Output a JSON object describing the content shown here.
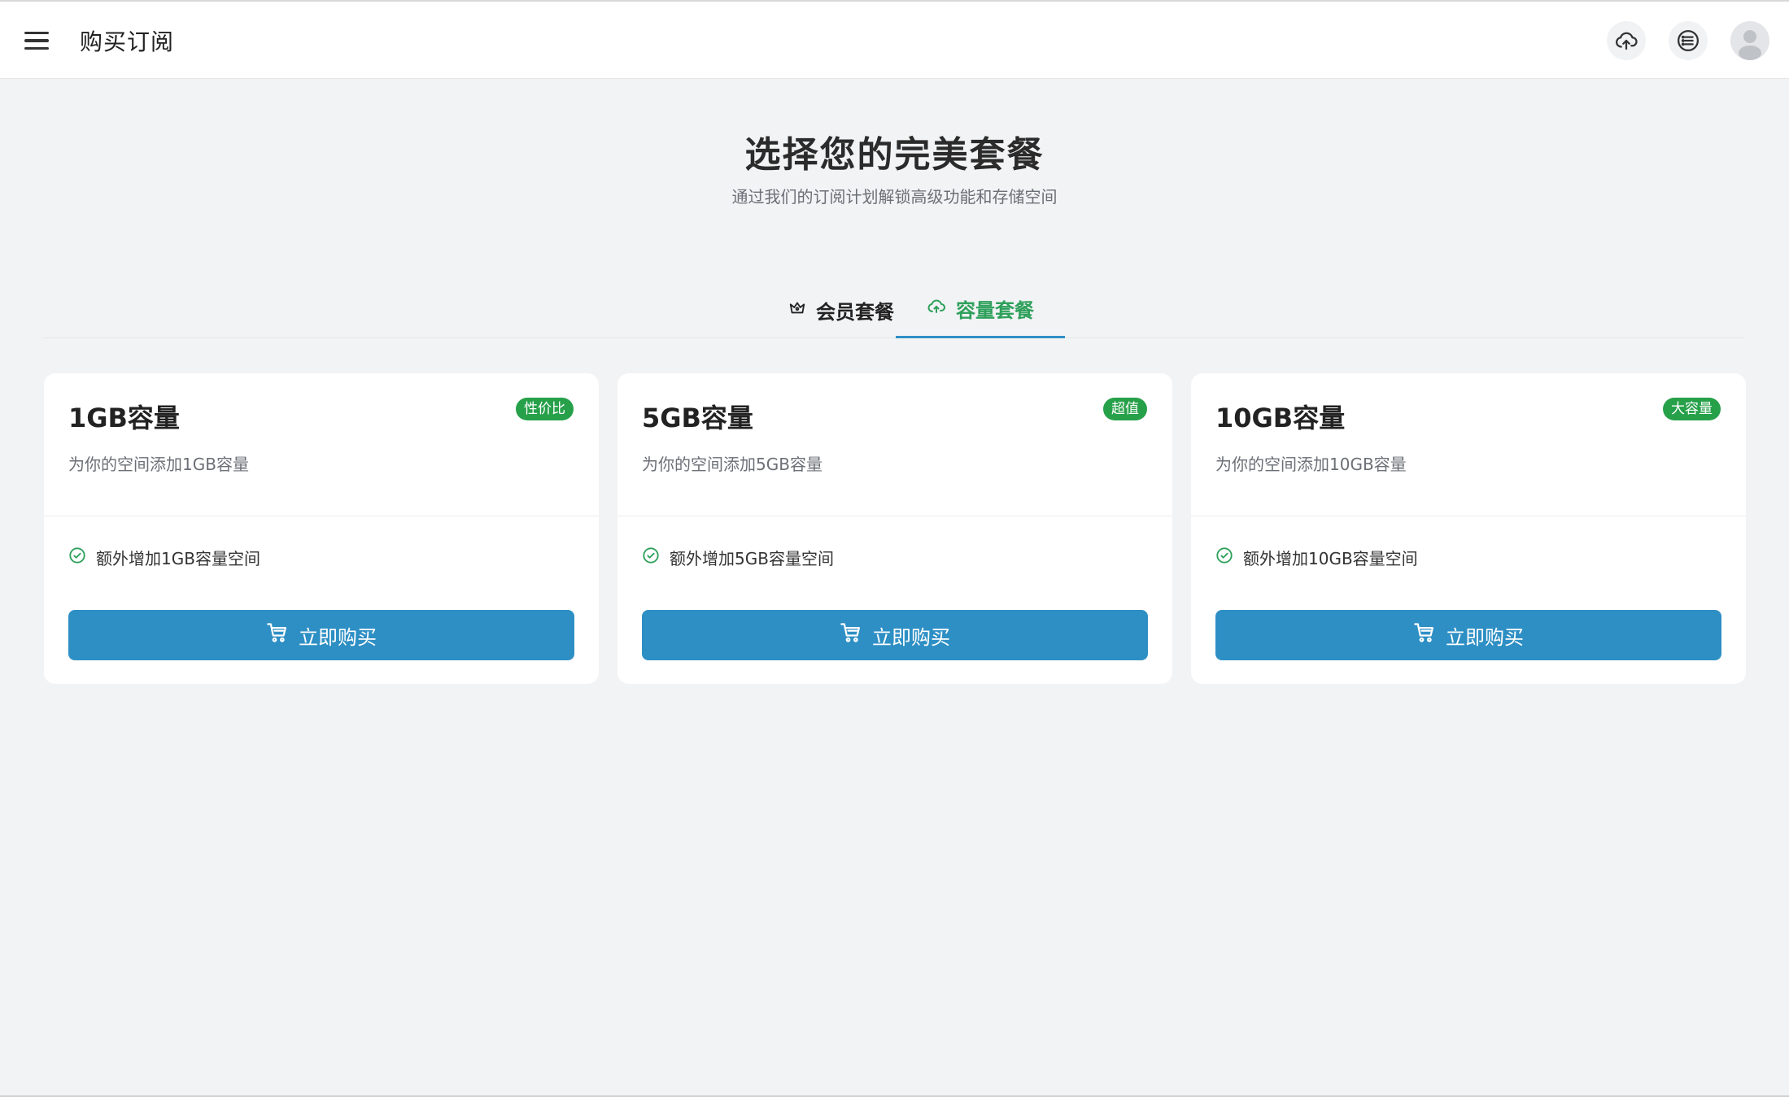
{
  "header": {
    "title": "购买订阅",
    "menu_icon": "hamburger-menu-icon",
    "actions": [
      {
        "name": "upload-cloud-icon"
      },
      {
        "name": "list-icon"
      },
      {
        "name": "avatar"
      }
    ]
  },
  "hero": {
    "title": "选择您的完美套餐",
    "subtitle": "通过我们的订阅计划解锁高级功能和存储空间"
  },
  "tabs": [
    {
      "label": "会员套餐",
      "icon": "crown-icon",
      "active": false
    },
    {
      "label": "容量套餐",
      "icon": "cloud-upload-icon",
      "active": true
    }
  ],
  "cards": [
    {
      "title": "1GB容量",
      "desc": "为你的空间添加1GB容量",
      "badge": "性价比",
      "feature": "额外增加1GB容量空间",
      "button": "立即购买"
    },
    {
      "title": "5GB容量",
      "desc": "为你的空间添加5GB容量",
      "badge": "超值",
      "feature": "额外增加5GB容量空间",
      "button": "立即购买"
    },
    {
      "title": "10GB容量",
      "desc": "为你的空间添加10GB容量",
      "badge": "大容量",
      "feature": "额外增加10GB容量空间",
      "button": "立即购买"
    }
  ],
  "colors": {
    "accent_blue": "#2e8fc4",
    "accent_green": "#27a04a",
    "background": "#f2f3f5"
  }
}
